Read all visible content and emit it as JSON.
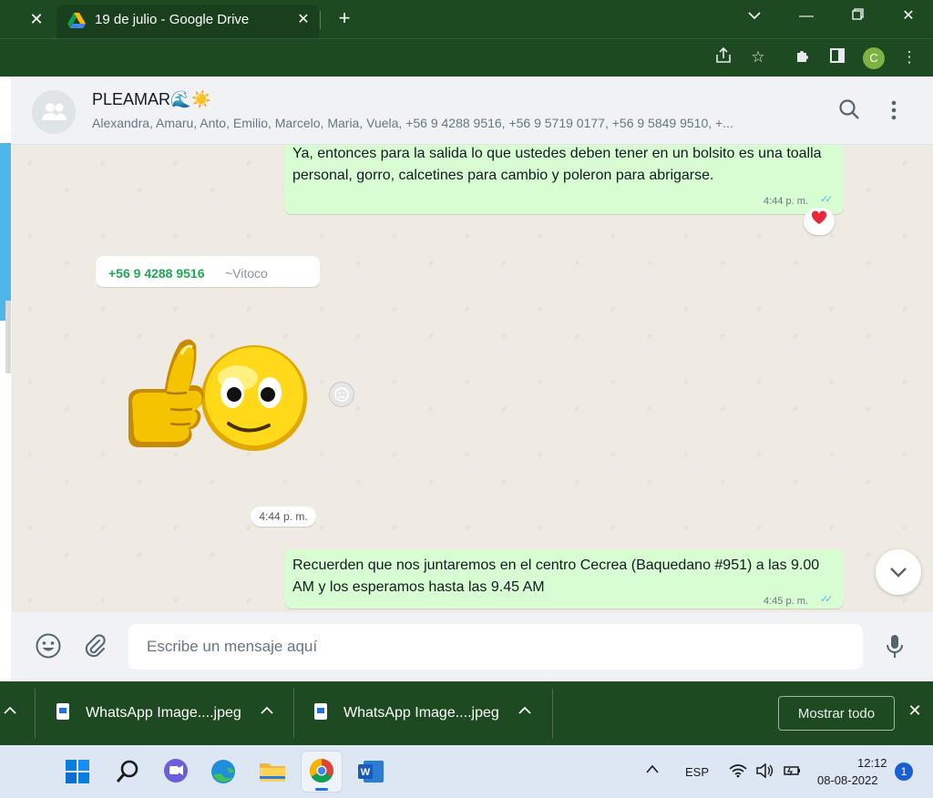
{
  "browser": {
    "tab_title": "19 de julio - Google Drive",
    "profile_initial": "C"
  },
  "chat": {
    "group_name": "PLEAMAR🌊☀️",
    "members": "Alexandra, Amaru, Anto, Emilio, Marcelo, Maria, Vuela, +56 9 4288 9516, +56 9 5719 0177, +56 9 5849 9510, +...",
    "messages": [
      {
        "text": "Ya, entonces para la salida lo que ustedes deben tener en un bolsito es una toalla personal, gorro, calcetines para cambio y poleron para abrigarse.",
        "time": "4:44 p. m.",
        "reaction": "❤️"
      },
      {
        "sender_phone": "+56 9 4288 9516",
        "sender_name": "~Vitoco",
        "sticker": "thumbs-up-smiley",
        "time": "4:44 p. m."
      },
      {
        "text": "Recuerden que nos juntaremos en el centro Cecrea (Baquedano #951) a las 9.00 AM y los esperamos hasta las 9.45 AM",
        "time": "4:45 p. m."
      }
    ]
  },
  "composer": {
    "placeholder": "Escribe un mensaje aquí"
  },
  "downloads": {
    "items": [
      {
        "name": "WhatsApp Image....jpeg"
      },
      {
        "name": "WhatsApp Image....jpeg"
      }
    ],
    "show_all_label": "Mostrar todo"
  },
  "taskbar": {
    "language": "ESP",
    "time": "12:12",
    "date": "08-08-2022",
    "notifications": "1"
  },
  "colors": {
    "browser_theme": "#1d4a21",
    "outgoing_bubble": "#d9fdd3",
    "sender_green": "#1fa855",
    "read_ticks": "#53bdeb"
  }
}
